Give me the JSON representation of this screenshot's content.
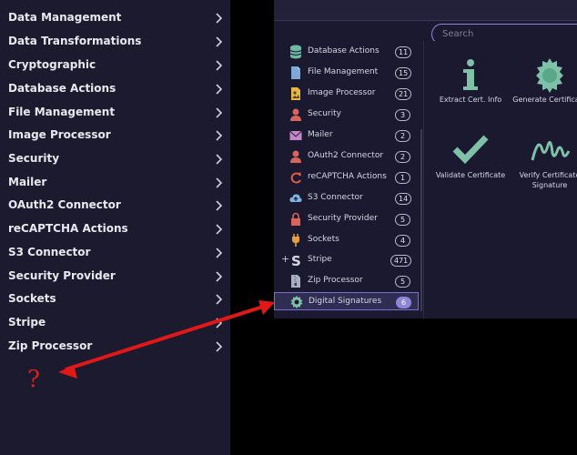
{
  "left_menu": {
    "items": [
      {
        "label": "Data Management",
        "icon": "chevron-right-icon"
      },
      {
        "label": "Data Transformations",
        "icon": "chevron-right-icon"
      },
      {
        "label": "Cryptographic",
        "icon": "chevron-right-icon"
      },
      {
        "label": "Database Actions",
        "icon": "chevron-right-icon"
      },
      {
        "label": "File Management",
        "icon": "chevron-right-icon"
      },
      {
        "label": "Image Processor",
        "icon": "chevron-right-icon"
      },
      {
        "label": "Security",
        "icon": "chevron-right-icon"
      },
      {
        "label": "Mailer",
        "icon": "chevron-right-icon"
      },
      {
        "label": "OAuth2 Connector",
        "icon": "chevron-right-icon"
      },
      {
        "label": "reCAPTCHA Actions",
        "icon": "chevron-right-icon"
      },
      {
        "label": "S3 Connector",
        "icon": "chevron-right-icon"
      },
      {
        "label": "Security Provider",
        "icon": "chevron-right-icon"
      },
      {
        "label": "Sockets",
        "icon": "chevron-right-icon"
      },
      {
        "label": "Stripe",
        "icon": "chevron-right-icon"
      },
      {
        "label": "Zip Processor",
        "icon": "chevron-right-icon"
      }
    ]
  },
  "search": {
    "placeholder": "Search"
  },
  "connectors": {
    "items": [
      {
        "label": "Database Actions",
        "count": "11",
        "icon": "database-icon"
      },
      {
        "label": "File Management",
        "count": "15",
        "icon": "file-icon"
      },
      {
        "label": "Image Processor",
        "count": "21",
        "icon": "image-file-icon"
      },
      {
        "label": "Security",
        "count": "3",
        "icon": "user-icon"
      },
      {
        "label": "Mailer",
        "count": "2",
        "icon": "envelope-icon"
      },
      {
        "label": "OAuth2 Connector",
        "count": "2",
        "icon": "user-icon"
      },
      {
        "label": "reCAPTCHA Actions",
        "count": "1",
        "icon": "refresh-icon"
      },
      {
        "label": "S3 Connector",
        "count": "14",
        "icon": "cloud-upload-icon"
      },
      {
        "label": "Security Provider",
        "count": "5",
        "icon": "lock-icon"
      },
      {
        "label": "Sockets",
        "count": "4",
        "icon": "plug-icon"
      },
      {
        "label": "Stripe",
        "count": "471",
        "icon": "stripe-icon",
        "expand": "+"
      },
      {
        "label": "Zip Processor",
        "count": "5",
        "icon": "zip-file-icon"
      },
      {
        "label": "Digital Signatures",
        "count": "6",
        "icon": "seal-icon",
        "selected": true
      }
    ]
  },
  "actions": {
    "items": [
      {
        "label": "Extract Cert. Info",
        "icon": "info-icon"
      },
      {
        "label": "Generate Certificate",
        "icon": "certificate-seal-icon"
      },
      {
        "label": "Validate Certificate",
        "icon": "checkmark-icon"
      },
      {
        "label": "Verify Certificate Signature",
        "icon": "signature-icon"
      }
    ]
  },
  "annotation": {
    "question": "?",
    "arrow_color": "#e01818"
  },
  "colors": {
    "accent": "#8f86d8",
    "panel_bg": "#1b1a2e",
    "annotation_red": "#d81e1e"
  }
}
